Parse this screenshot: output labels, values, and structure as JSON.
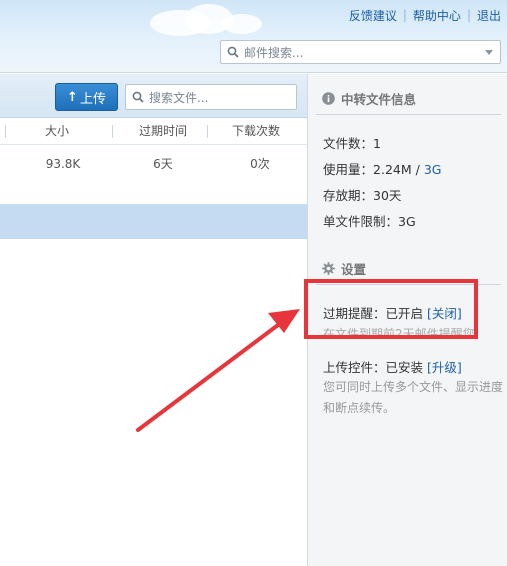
{
  "header": {
    "links": [
      "反馈建议",
      "帮助中心",
      "退出"
    ],
    "mail_search_placeholder": "邮件搜索..."
  },
  "toolbar": {
    "upload_label": "上传",
    "file_search_placeholder": "搜索文件..."
  },
  "table": {
    "columns": [
      "大小",
      "过期时间",
      "下载次数"
    ],
    "rows": [
      {
        "size": "93.8K",
        "expire": "6天",
        "downloads": "0次"
      }
    ]
  },
  "info": {
    "title": "中转文件信息",
    "file_count_label": "文件数：",
    "file_count": "1",
    "usage_label": "使用量：",
    "usage_used": "2.24M",
    "usage_sep": " / ",
    "usage_total": "3G",
    "retention_label": "存放期：",
    "retention": "30天",
    "limit_label": "单文件限制：",
    "limit": "3G"
  },
  "settings": {
    "title": "设置",
    "expiry_label": "过期提醒：",
    "expiry_value": "已开启",
    "expiry_action": "[关闭]",
    "expiry_hint": "在文件到期前2天邮件提醒您",
    "plugin_label": "上传控件：",
    "plugin_value": "已安装",
    "plugin_action": "[升级]",
    "plugin_desc": "您可同时上传多个文件、显示进度和断点续传。"
  },
  "colors": {
    "accent": "#1c5fa8",
    "button": "#2a7cc6",
    "highlight": "#e8353b",
    "selected_row": "#c4dbf1"
  },
  "icons": [
    "search-icon",
    "chevron-down-icon",
    "upload-arrow-icon",
    "info-icon",
    "gear-icon"
  ]
}
